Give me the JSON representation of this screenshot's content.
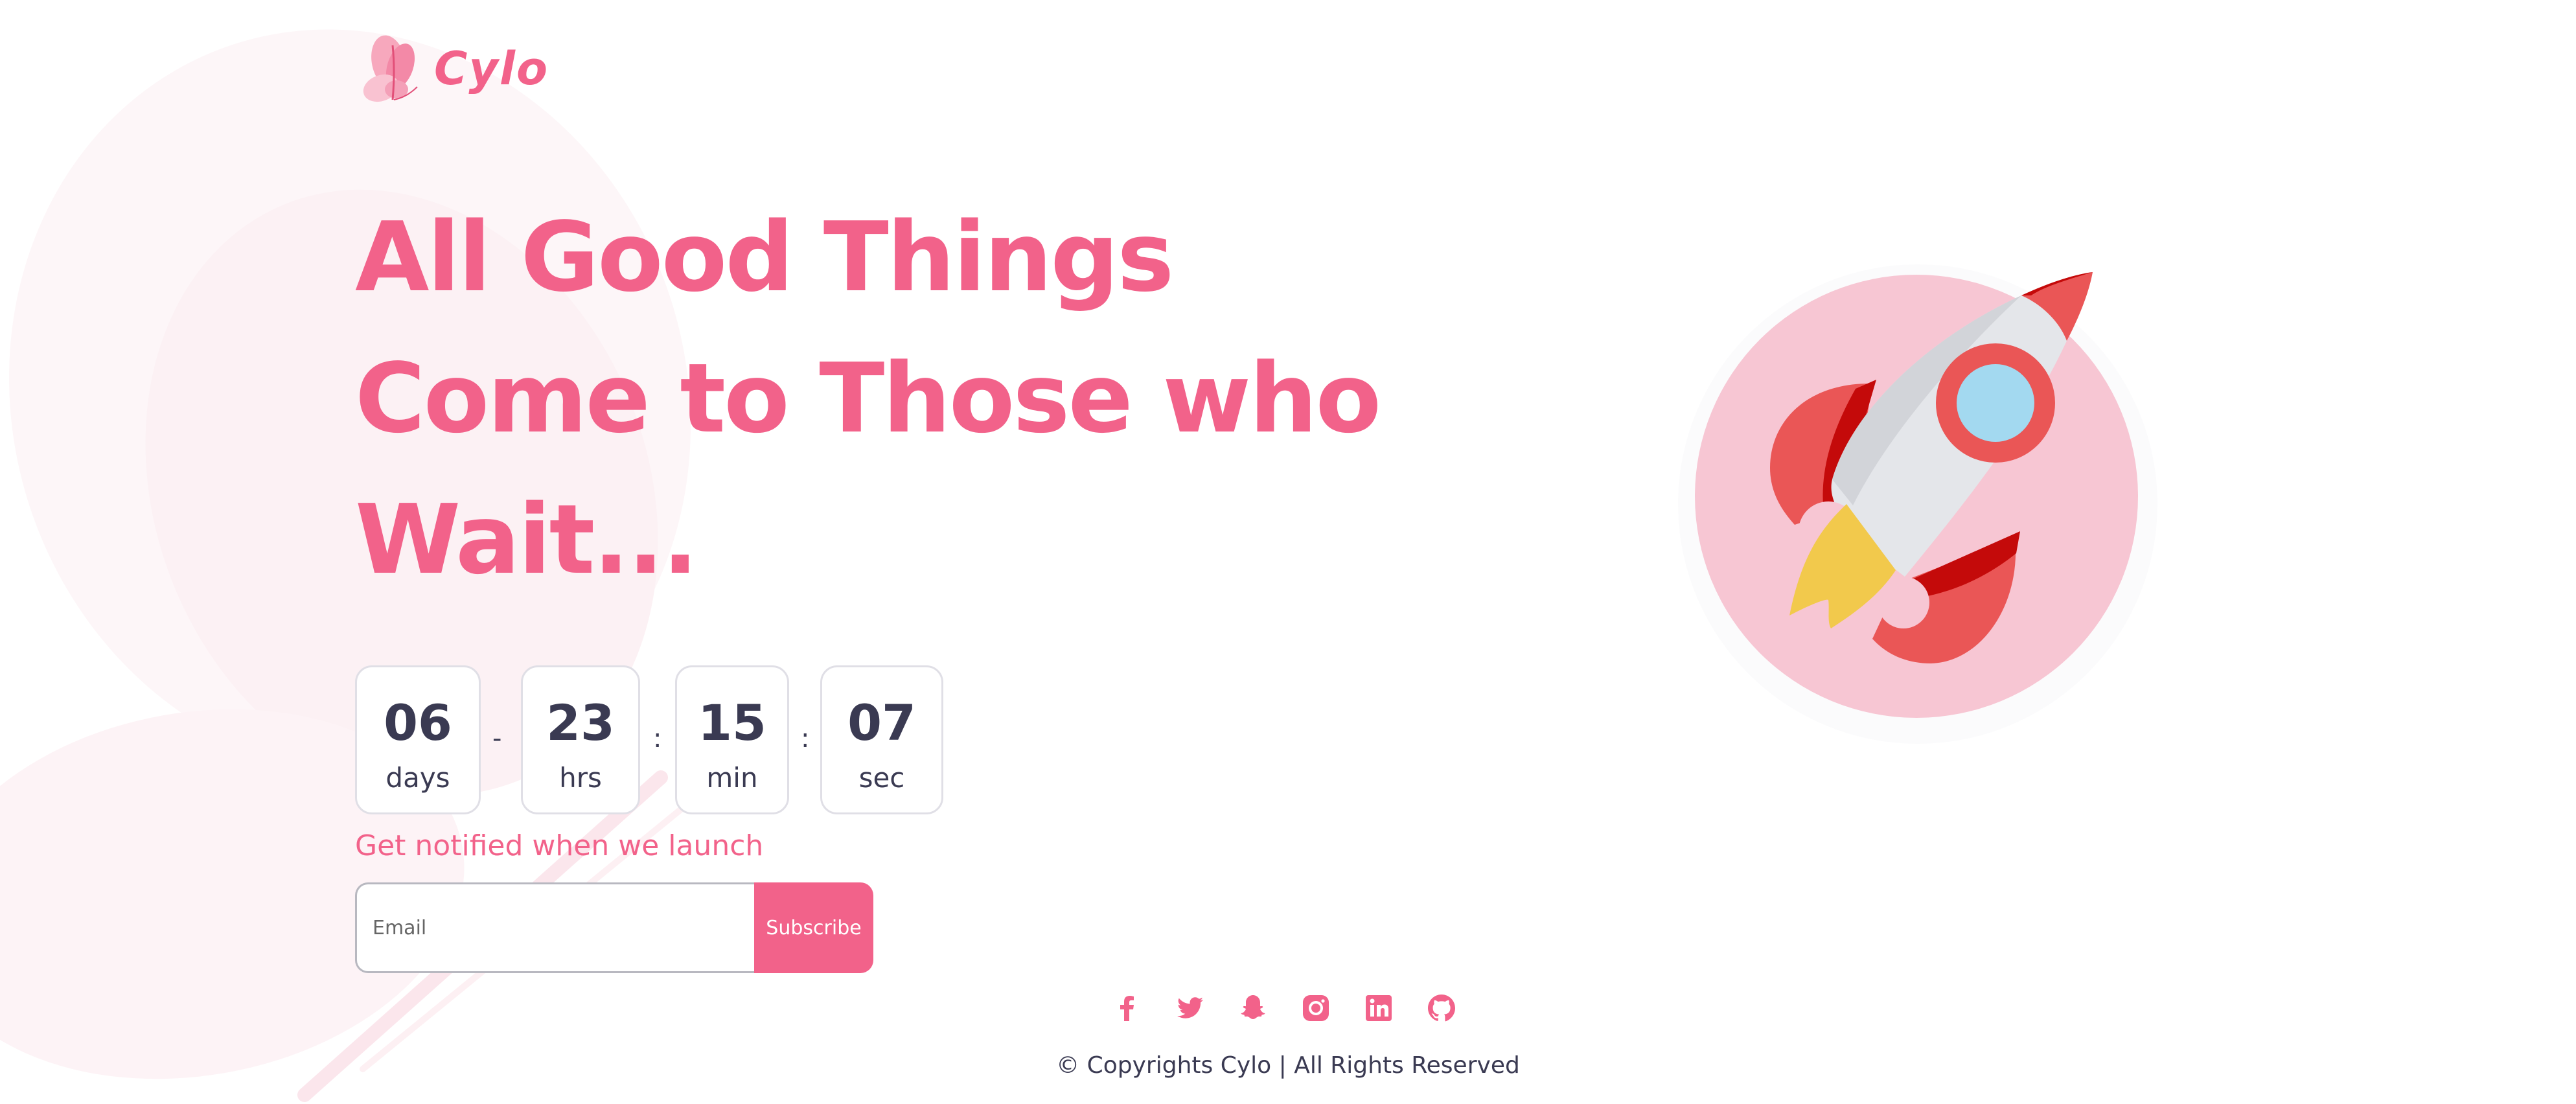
{
  "brand": {
    "name": "Cylo",
    "logo_icon": "butterfly-icon",
    "accent_color": "#f2628a"
  },
  "hero": {
    "headline_lines": [
      "All Good Things",
      "Come to Those who",
      "Wait..."
    ]
  },
  "countdown": {
    "items": [
      {
        "value": "06",
        "unit": "days"
      },
      {
        "value": "23",
        "unit": "hrs"
      },
      {
        "value": "15",
        "unit": "min"
      },
      {
        "value": "07",
        "unit": "sec"
      }
    ],
    "separators": [
      "-",
      ":",
      ":"
    ]
  },
  "notify": {
    "text": "Get notified when we launch",
    "email_placeholder": "Email",
    "subscribe_label": "Subscribe"
  },
  "illustration": {
    "icon": "rocket-icon"
  },
  "social": {
    "icons": [
      "facebook-icon",
      "twitter-icon",
      "snapchat-icon",
      "instagram-icon",
      "linkedin-icon",
      "github-icon"
    ]
  },
  "footer": {
    "copyright": "© Copyrights Cylo | All Rights Reserved"
  }
}
